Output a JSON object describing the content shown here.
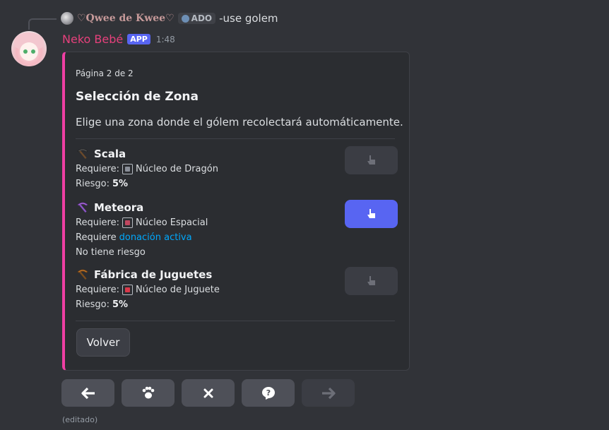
{
  "reply": {
    "author": "♡Qwee de Kwee♡",
    "tag": "ADO",
    "text": "-use golem"
  },
  "message": {
    "author": "Neko Bebé",
    "badge": "APP",
    "time": "1:48",
    "edited": "(editado)"
  },
  "embed": {
    "accent_color": "#ef3fa3",
    "footer": "Página 2 de 2",
    "title": "Selección de Zona",
    "description": "Elige una zona donde el gólem recolectará automáticamente.",
    "zones": [
      {
        "name": "Scala",
        "icon": "pickaxe-dark-icon",
        "require_label": "Requiere:",
        "core_name": "Núcleo de Dragón",
        "risk_label": "Riesgo:",
        "risk_value": "5%",
        "button_state": "disabled"
      },
      {
        "name": "Meteora",
        "icon": "pickaxe-purple-icon",
        "require_label": "Requiere:",
        "core_name": "Núcleo Espacial",
        "donation_prefix": "Requiere",
        "donation_link": "donación activa",
        "risk_text": "No tiene riesgo",
        "button_state": "active"
      },
      {
        "name": "Fábrica de Juguetes",
        "icon": "pickaxe-orange-icon",
        "require_label": "Requiere:",
        "core_name": "Núcleo de Juguete",
        "risk_label": "Riesgo:",
        "risk_value": "5%",
        "button_state": "disabled"
      }
    ],
    "back_button": "Volver"
  },
  "action_buttons": [
    {
      "icon": "arrow-left-icon",
      "state": "enabled"
    },
    {
      "icon": "paw-icon",
      "state": "enabled"
    },
    {
      "icon": "close-icon",
      "state": "enabled"
    },
    {
      "icon": "question-icon",
      "state": "enabled"
    },
    {
      "icon": "arrow-right-icon",
      "state": "disabled"
    }
  ]
}
